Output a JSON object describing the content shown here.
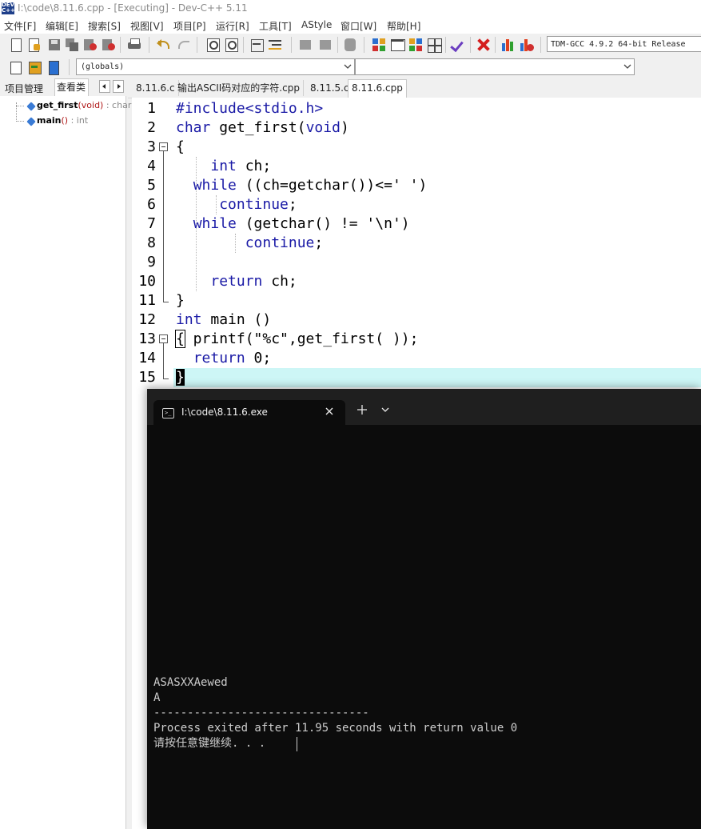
{
  "window": {
    "title": "I:\\code\\8.11.6.cpp - [Executing] - Dev-C++ 5.11",
    "icon_text_top": "DEV",
    "icon_text_bottom": "C++"
  },
  "menu": [
    "文件[F]",
    "编辑[E]",
    "搜索[S]",
    "视图[V]",
    "项目[P]",
    "运行[R]",
    "工具[T]",
    "AStyle",
    "窗口[W]",
    "帮助[H]"
  ],
  "toolbar": {
    "compiler": "TDM-GCC 4.9.2 64-bit Release",
    "globals": "(globals)"
  },
  "left_panel": {
    "tabs": [
      "项目管理",
      "查看类"
    ],
    "tree": [
      {
        "name": "get_first",
        "params": "(void)",
        "type": ": char"
      },
      {
        "name": "main",
        "params": "()",
        "type": ": int"
      }
    ]
  },
  "editor": {
    "tabs": [
      "8.11.6.c",
      "输出ASCII码对应的字符.cpp",
      "8.11.5.c",
      "8.11.6.cpp"
    ],
    "active_tab": "8.11.6.cpp",
    "line_numbers": [
      "1",
      "2",
      "3",
      "4",
      "5",
      "6",
      "7",
      "8",
      "9",
      "10",
      "11",
      "12",
      "13",
      "14",
      "15"
    ],
    "lines": [
      "#include<stdio.h>",
      "char get_first(void)",
      "{",
      "    int ch;",
      "  while ((ch=getchar())<=' ')",
      "     continue;",
      "  while (getchar() != '\\n')",
      "        continue;",
      "",
      "    return ch;",
      "}",
      "int main ()",
      "{ printf(\"%c\",get_first( ));",
      "  return 0;",
      "}"
    ],
    "current_line": 15
  },
  "console": {
    "title": "I:\\code\\8.11.6.exe",
    "icon_glyph": ">_",
    "lines": [
      "ASASXXAewed",
      "A",
      "--------------------------------",
      "Process exited after 11.95 seconds with return value 0",
      "请按任意键继续. . . "
    ]
  },
  "colors": {
    "keyword": "#1a1aa6",
    "current_line": "#cdf6f6",
    "console_bg": "#0c0c0c",
    "console_text": "#cccccc"
  }
}
